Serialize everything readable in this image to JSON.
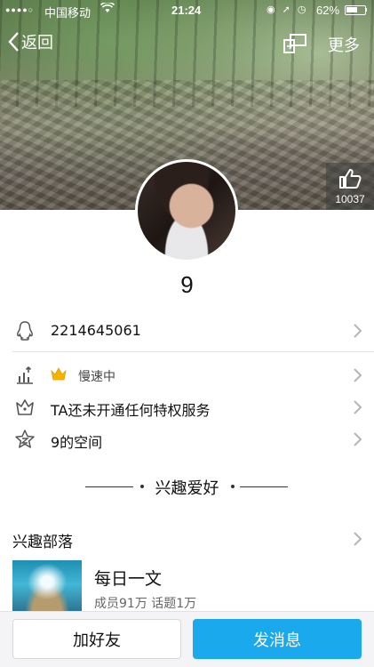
{
  "status_bar": {
    "signal": "●●●●○",
    "carrier": "中国移动",
    "time": "21:24",
    "battery_pct": "62%",
    "battery_level": 0.62
  },
  "nav": {
    "back_label": "返回",
    "more_label": "更多"
  },
  "cover": {
    "like_count": "10037"
  },
  "profile": {
    "nickname": "9"
  },
  "info_rows": {
    "qq_number": "2214645061",
    "level_status": "慢速中",
    "privilege": "TA还未开通任何特权服务",
    "space": "9的空间"
  },
  "interests": {
    "section_title": "兴趣爱好",
    "tribe_header": "兴趣部落",
    "tribe": {
      "name": "每日一文",
      "meta": "成员91万 话题1万"
    }
  },
  "actions": {
    "add_friend": "加好友",
    "send_message": "发消息"
  },
  "colors": {
    "accent": "#19a9ec",
    "crown": "#f5b400"
  }
}
